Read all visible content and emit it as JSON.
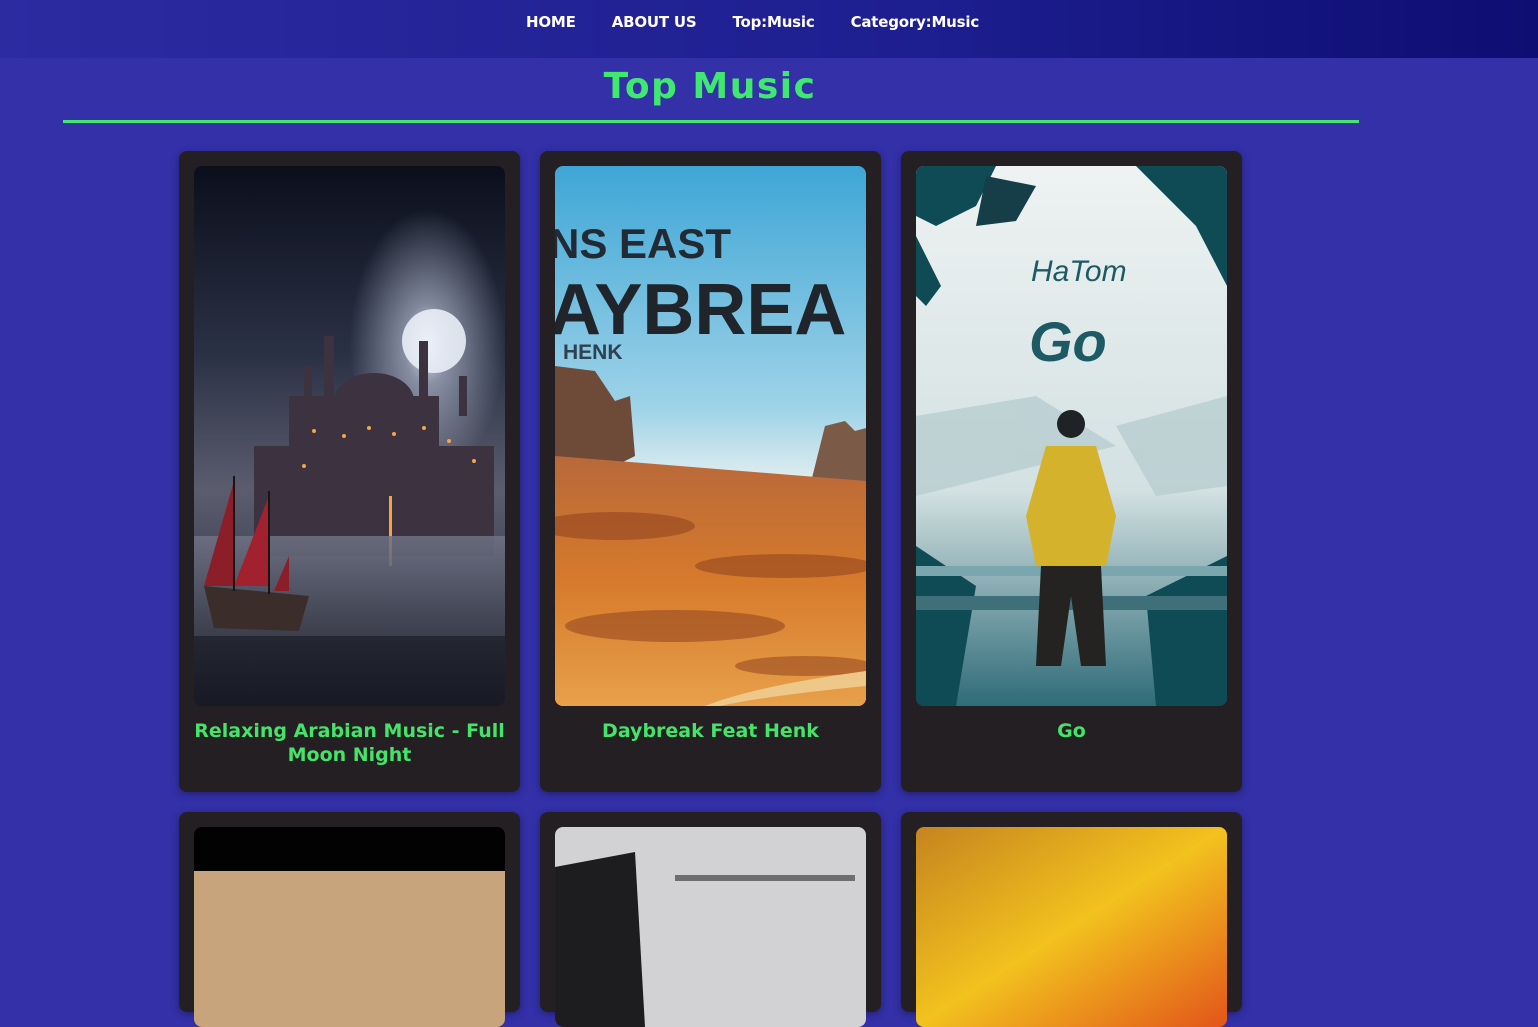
{
  "nav": {
    "items": [
      {
        "label": "HOME"
      },
      {
        "label": "ABOUT US"
      },
      {
        "label": "Top:Music"
      },
      {
        "label": "Category:Music"
      }
    ]
  },
  "page": {
    "title": "Top Music"
  },
  "cards": [
    {
      "title": "Relaxing Arabian Music - Full Moon Night"
    },
    {
      "title": "Daybreak Feat Henk",
      "art_text": {
        "line1": "NS EAST",
        "line2": "AYBREA",
        "line3": "HENK"
      }
    },
    {
      "title": "Go",
      "art_text": {
        "artist": "HaTom",
        "song": "Go"
      }
    },
    {
      "title": ""
    },
    {
      "title": ""
    },
    {
      "title": ""
    }
  ],
  "colors": {
    "background": "#3330a8",
    "accent_green": "#3fe86f",
    "card_bg": "#241f22",
    "nav_text": "#ffffff"
  }
}
